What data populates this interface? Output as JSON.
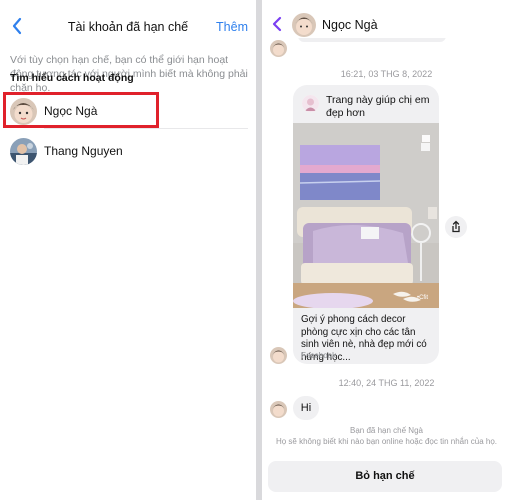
{
  "left": {
    "header": {
      "title": "Tài khoản đã hạn chế",
      "add_label": "Thêm"
    },
    "description": "Với tùy chọn hạn chế, bạn có thể giới hạn hoạt động tương tác với người mình biết mà không phải chặn họ.",
    "learn_more": "Tìm hiểu cách hoạt động",
    "users": [
      {
        "name": "Ngọc Ngà",
        "highlighted": true
      },
      {
        "name": "Thang Nguyen",
        "highlighted": false
      }
    ],
    "colors": {
      "accent": "#2f80ed",
      "highlight": "#e0212b"
    }
  },
  "right": {
    "header": {
      "name": "Ngọc Ngà",
      "back_icon": "chevron-left-icon",
      "back_color": "#7a3ff2"
    },
    "timestamps": [
      "16:21, 03 THG 8, 2022",
      "12:40, 24 THG 11, 2022"
    ],
    "card": {
      "title": "Trang này giúp chị em đẹp hơn",
      "description": "Gợi ý phong cách decor phòng cực xịn cho các tân sinh viên nè, nhà đẹp mới có hứng học...",
      "source": "Facebook",
      "photo_badge": "•Cfit"
    },
    "message": "Hi",
    "footer": {
      "restricted_title": "Bạn đã hạn chế Ngà",
      "restricted_desc": "Họ sẽ không biết khi nào bạn online hoặc đọc tin nhắn của họ.",
      "unrestrict_label": "Bỏ hạn chế"
    }
  }
}
